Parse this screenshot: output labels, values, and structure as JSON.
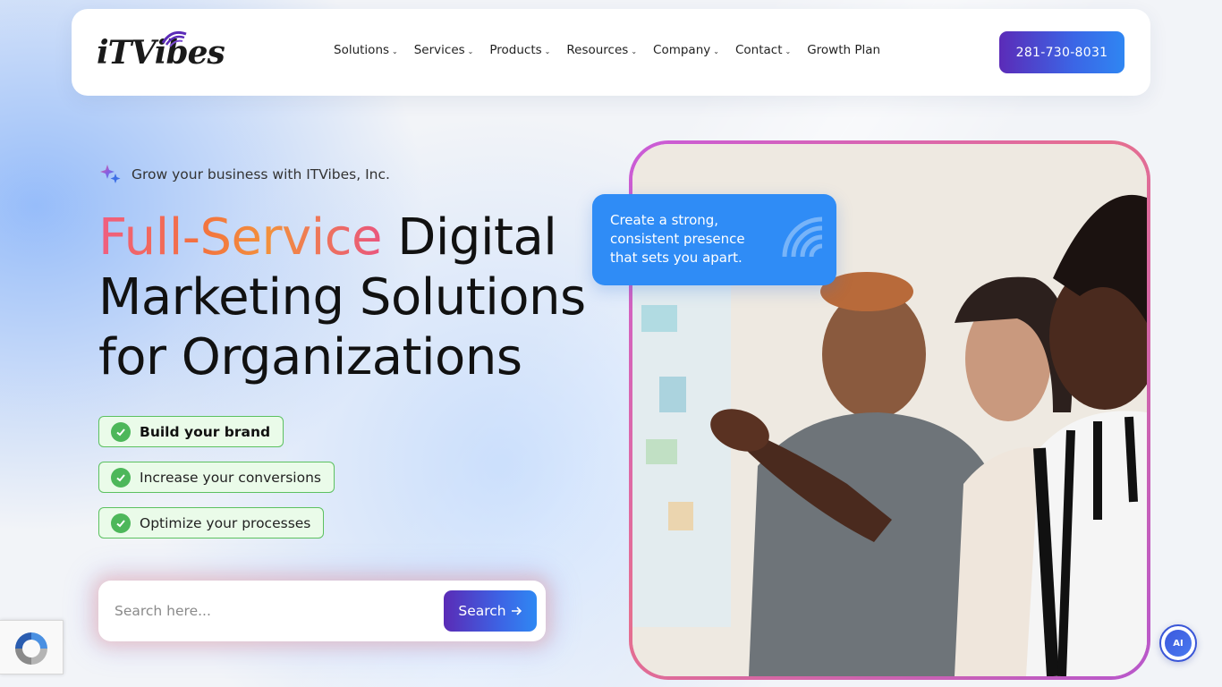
{
  "brand": {
    "logo_text": "iTVibes",
    "logo_prefix": "iT",
    "logo_suffix": "Vibes"
  },
  "nav": {
    "items": [
      {
        "label": "Solutions",
        "has_dropdown": true
      },
      {
        "label": "Services",
        "has_dropdown": true
      },
      {
        "label": "Products",
        "has_dropdown": true
      },
      {
        "label": "Resources",
        "has_dropdown": true
      },
      {
        "label": "Company",
        "has_dropdown": true
      },
      {
        "label": "Contact",
        "has_dropdown": true
      },
      {
        "label": "Growth Plan",
        "has_dropdown": false
      }
    ],
    "phone": "281-730-8031"
  },
  "hero": {
    "tagline": "Grow your business with ITVibes, Inc.",
    "headline_highlight": "Full-Service",
    "headline_line1_rest": " Digital",
    "headline_line2": "Marketing Solutions",
    "headline_line3": "for Organizations",
    "benefits": [
      {
        "label": "Build your brand",
        "bold": true
      },
      {
        "label": "Increase your conversions",
        "bold": false
      },
      {
        "label": "Optimize your processes",
        "bold": false
      }
    ],
    "search": {
      "placeholder": "Search here...",
      "button_label": "Search",
      "button_icon": "arrow-right-icon"
    },
    "callout": "Create a strong, consistent presence that sets you apart."
  },
  "icons": {
    "tagline_icon": "sparkle-icon",
    "benefit_icon": "check-circle-icon",
    "callout_icon": "signal-waves-icon",
    "recaptcha_icon": "recaptcha-icon",
    "ai_icon": "ai-assistant-icon"
  },
  "ai_button_label": "AI",
  "colors": {
    "accent_purple": "#5b2bb8",
    "accent_blue": "#2f8cf6",
    "highlight_gradient": [
      "#ef5e82",
      "#f3713f",
      "#e9557e"
    ],
    "benefit_green": "#4db75a",
    "frame_gradient": [
      "#c95bd9",
      "#e66f8f"
    ]
  }
}
